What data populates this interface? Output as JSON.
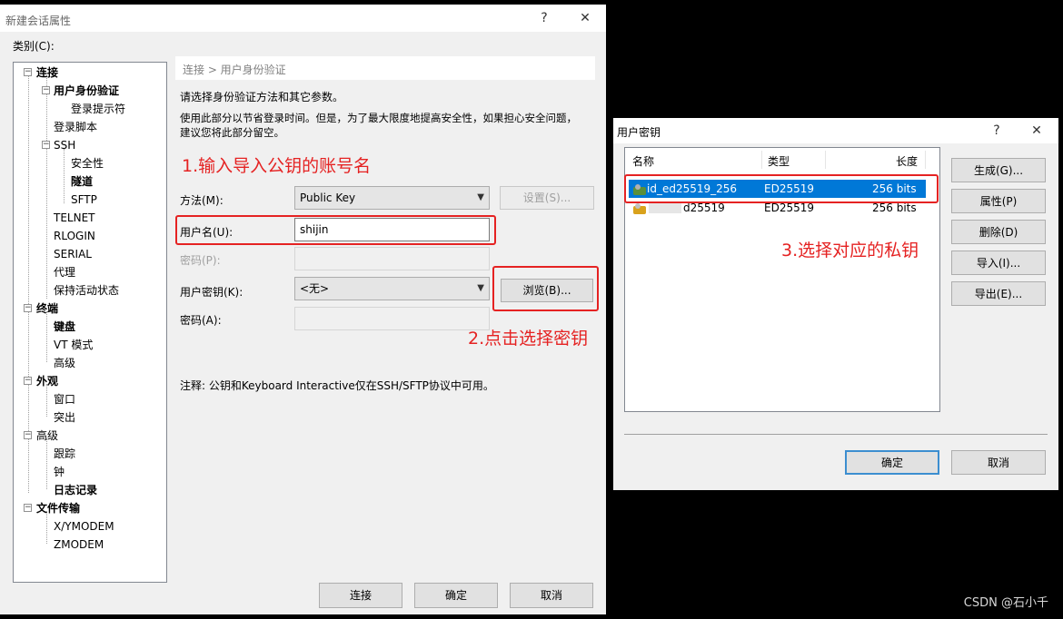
{
  "session_dialog": {
    "title": "新建会话属性",
    "help_icon": "?",
    "close_icon": "✕",
    "category_label": "类别(C):",
    "tree": [
      {
        "label": "连接",
        "bold": true
      },
      {
        "label": "用户身份验证",
        "bold": true
      },
      {
        "label": "登录提示符",
        "bold": false
      },
      {
        "label": "登录脚本",
        "bold": false
      },
      {
        "label": "SSH",
        "bold": false
      },
      {
        "label": "安全性",
        "bold": false
      },
      {
        "label": "隧道",
        "bold": true
      },
      {
        "label": "SFTP",
        "bold": false
      },
      {
        "label": "TELNET",
        "bold": false
      },
      {
        "label": "RLOGIN",
        "bold": false
      },
      {
        "label": "SERIAL",
        "bold": false
      },
      {
        "label": "代理",
        "bold": false
      },
      {
        "label": "保持活动状态",
        "bold": false
      },
      {
        "label": "终端",
        "bold": true
      },
      {
        "label": "键盘",
        "bold": true
      },
      {
        "label": "VT 模式",
        "bold": false
      },
      {
        "label": "高级",
        "bold": false
      },
      {
        "label": "外观",
        "bold": true
      },
      {
        "label": "窗口",
        "bold": false
      },
      {
        "label": "突出",
        "bold": false
      },
      {
        "label": "高级",
        "bold": false
      },
      {
        "label": "跟踪",
        "bold": false
      },
      {
        "label": "钟",
        "bold": false
      },
      {
        "label": "日志记录",
        "bold": true
      },
      {
        "label": "文件传输",
        "bold": true
      },
      {
        "label": "X/YMODEM",
        "bold": false
      },
      {
        "label": "ZMODEM",
        "bold": false
      }
    ],
    "breadcrumb": "连接 > 用户身份验证",
    "intro": "请选择身份验证方法和其它参数。",
    "description_line1": "使用此部分以节省登录时间。但是，为了最大限度地提高安全性，如果担心安全问题，",
    "description_line2": "建议您将此部分留空。",
    "method_label": "方法(M):",
    "method_value": "Public Key",
    "settings_button": "设置(S)...",
    "username_label": "用户名(U):",
    "username_value": "shijin",
    "password_label": "密码(P):",
    "user_key_label": "用户密钥(K):",
    "user_key_value": "<无>",
    "browse_button": "浏览(B)...",
    "passphrase_label": "密码(A):",
    "note": "注释: 公钥和Keyboard Interactive仅在SSH/SFTP协议中可用。",
    "buttons": {
      "connect": "连接",
      "ok": "确定",
      "cancel": "取消"
    }
  },
  "annotations": {
    "step1": "1.输入导入公钥的账号名",
    "step2": "2.点击选择密钥",
    "step3": "3.选择对应的私钥"
  },
  "key_dialog": {
    "title": "用户密钥",
    "help_icon": "?",
    "close_icon": "✕",
    "columns": {
      "name": "名称",
      "type": "类型",
      "length": "长度"
    },
    "rows": [
      {
        "name": "id_ed25519_256",
        "type": "ED25519",
        "length": "256 bits",
        "selected": true
      },
      {
        "name": "d25519",
        "type": "ED25519",
        "length": "256 bits",
        "selected": false
      }
    ],
    "buttons": {
      "generate": "生成(G)...",
      "properties": "属性(P)",
      "delete": "删除(D)",
      "import": "导入(I)...",
      "export": "导出(E)...",
      "ok": "确定",
      "cancel": "取消"
    }
  },
  "watermark": "CSDN @石小千",
  "colors": {
    "annotation_red": "#e52222",
    "selection_blue": "#0078d7"
  }
}
